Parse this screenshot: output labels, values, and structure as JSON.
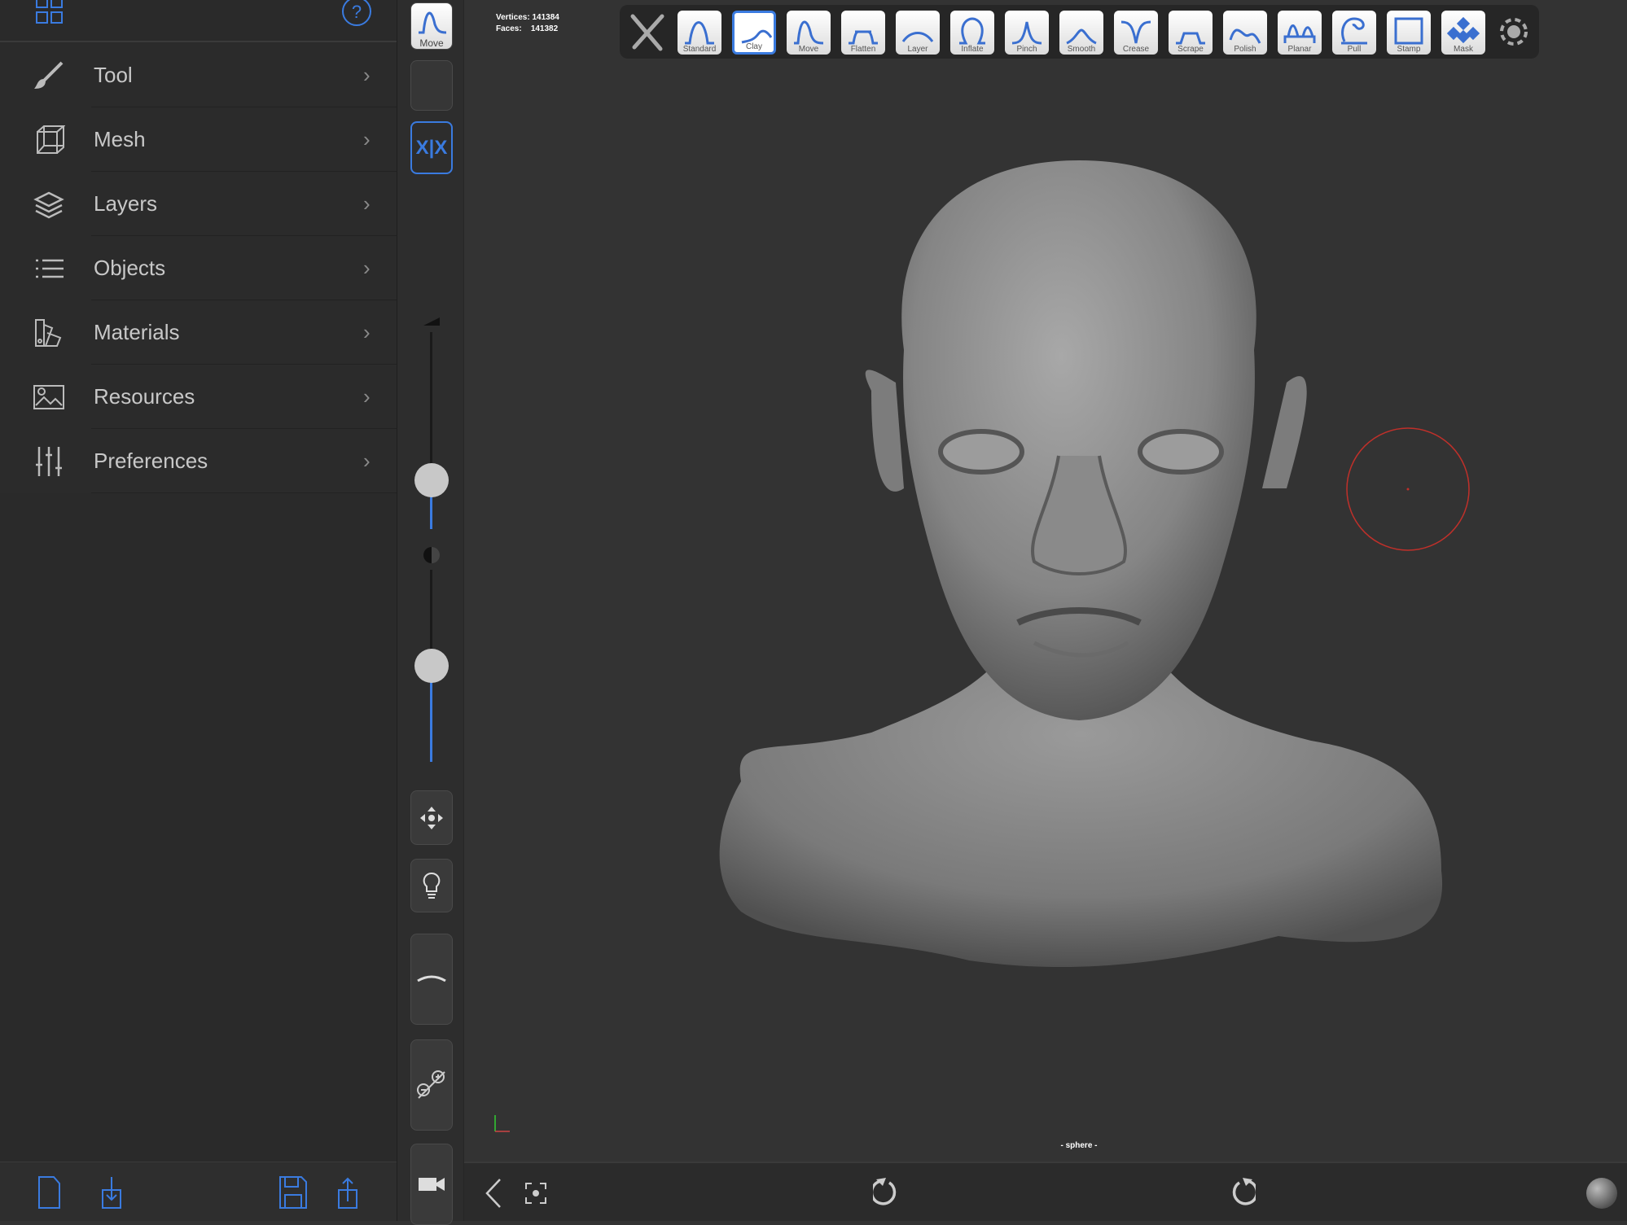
{
  "sidebar": {
    "top_icons": [
      "grid-icon",
      "help-icon"
    ],
    "items": [
      {
        "label": "Tool",
        "icon": "brush-icon"
      },
      {
        "label": "Mesh",
        "icon": "cube-icon"
      },
      {
        "label": "Layers",
        "icon": "layers-icon"
      },
      {
        "label": "Objects",
        "icon": "list-icon"
      },
      {
        "label": "Materials",
        "icon": "swatches-icon"
      },
      {
        "label": "Resources",
        "icon": "image-icon"
      },
      {
        "label": "Preferences",
        "icon": "sliders-icon"
      }
    ],
    "bottom_icons": [
      "new-file-icon",
      "import-icon",
      "save-icon",
      "export-icon"
    ]
  },
  "column": {
    "current_tool": "Move",
    "symmetry_label": "X|X",
    "radius_slider": 0.3,
    "intensity_slider": 0.5
  },
  "viewport": {
    "stats": {
      "vertices_label": "Vertices:",
      "vertices": "141384",
      "faces_label": "Faces:",
      "faces": "141382"
    },
    "object_name": "- sphere -",
    "accent": "#3a7be0",
    "cursor_color": "#c0302a"
  },
  "toolbar": {
    "tools": [
      "Standard",
      "Clay",
      "Move",
      "Flatten",
      "Layer",
      "Inflate",
      "Pinch",
      "Smooth",
      "Crease",
      "Scrape",
      "Polish",
      "Planar",
      "Pull",
      "Stamp",
      "Mask"
    ],
    "selected": "Clay"
  }
}
